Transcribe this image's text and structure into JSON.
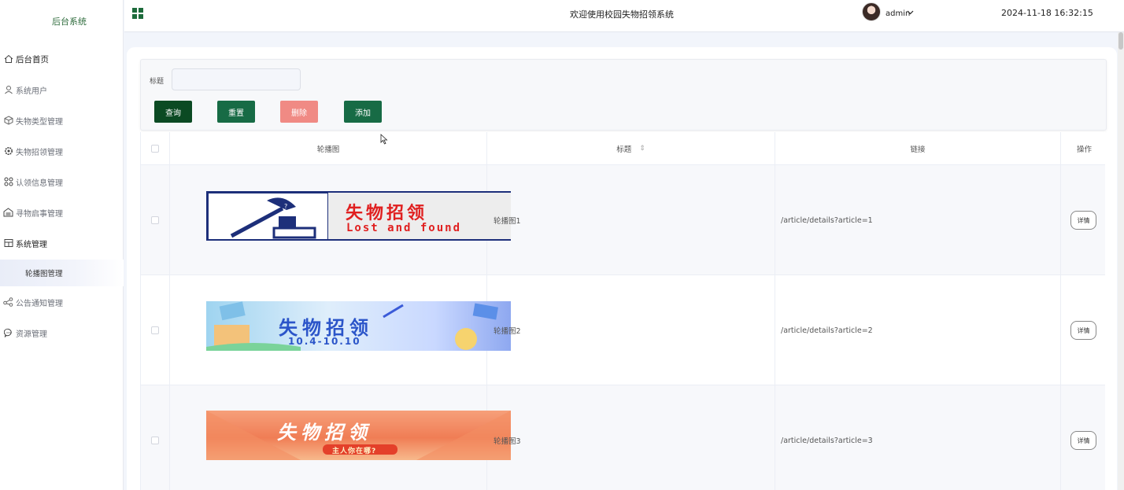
{
  "sidebar": {
    "brand": "后台系统",
    "items": [
      {
        "label": "后台首页",
        "icon": "home-icon"
      },
      {
        "label": "系统用户",
        "icon": "user-icon"
      },
      {
        "label": "失物类型管理",
        "icon": "cube-icon"
      },
      {
        "label": "失物招领管理",
        "icon": "gear-icon"
      },
      {
        "label": "认领信息管理",
        "icon": "grid-icon"
      },
      {
        "label": "寻物启事管理",
        "icon": "clipboard-icon"
      },
      {
        "label": "系统管理",
        "icon": "layout-icon"
      },
      {
        "label": "公告通知管理",
        "icon": "share-icon"
      },
      {
        "label": "资源管理",
        "icon": "chat-icon"
      }
    ],
    "active_sub": "轮播图管理"
  },
  "header": {
    "title": "欢迎使用校园失物招领系统",
    "user": "admin",
    "datetime": "2024-11-18 16:32:15"
  },
  "search": {
    "label": "标题",
    "placeholder": "",
    "buttons": {
      "query": "查询",
      "reset": "重置",
      "delete": "删除",
      "add": "添加"
    }
  },
  "table": {
    "headers": {
      "image": "轮播图",
      "title": "标题",
      "sort": "⇕",
      "link": "链接",
      "action": "操作"
    },
    "rows": [
      {
        "title": "轮播图1",
        "link": "/article/details?article=1",
        "banner_text": "失物招领",
        "banner_sub": "Lost and found",
        "action": "详情"
      },
      {
        "title": "轮播图2",
        "link": "/article/details?article=2",
        "banner_text": "失物招领",
        "banner_sub": "10.4-10.10",
        "action": "详情"
      },
      {
        "title": "轮播图3",
        "link": "/article/details?article=3",
        "banner_text": "失物招领",
        "banner_sub": "主人你在哪?",
        "action": "详情"
      }
    ]
  },
  "colors": {
    "brand_green": "#176b45",
    "dark_green": "#0b4a23",
    "danger": "#f08a84"
  }
}
